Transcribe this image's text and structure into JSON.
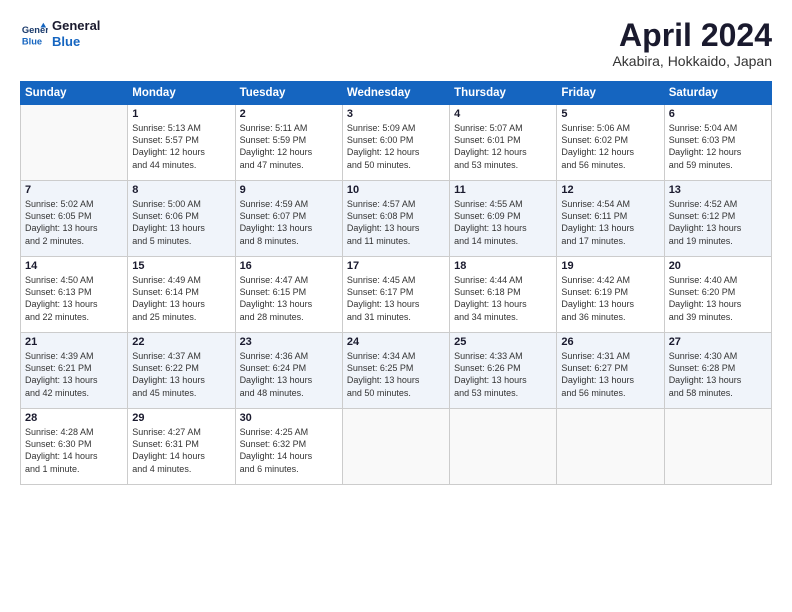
{
  "logo": {
    "line1": "General",
    "line2": "Blue"
  },
  "title": "April 2024",
  "location": "Akabira, Hokkaido, Japan",
  "days_of_week": [
    "Sunday",
    "Monday",
    "Tuesday",
    "Wednesday",
    "Thursday",
    "Friday",
    "Saturday"
  ],
  "weeks": [
    [
      {
        "num": "",
        "info": ""
      },
      {
        "num": "1",
        "info": "Sunrise: 5:13 AM\nSunset: 5:57 PM\nDaylight: 12 hours\nand 44 minutes."
      },
      {
        "num": "2",
        "info": "Sunrise: 5:11 AM\nSunset: 5:59 PM\nDaylight: 12 hours\nand 47 minutes."
      },
      {
        "num": "3",
        "info": "Sunrise: 5:09 AM\nSunset: 6:00 PM\nDaylight: 12 hours\nand 50 minutes."
      },
      {
        "num": "4",
        "info": "Sunrise: 5:07 AM\nSunset: 6:01 PM\nDaylight: 12 hours\nand 53 minutes."
      },
      {
        "num": "5",
        "info": "Sunrise: 5:06 AM\nSunset: 6:02 PM\nDaylight: 12 hours\nand 56 minutes."
      },
      {
        "num": "6",
        "info": "Sunrise: 5:04 AM\nSunset: 6:03 PM\nDaylight: 12 hours\nand 59 minutes."
      }
    ],
    [
      {
        "num": "7",
        "info": "Sunrise: 5:02 AM\nSunset: 6:05 PM\nDaylight: 13 hours\nand 2 minutes."
      },
      {
        "num": "8",
        "info": "Sunrise: 5:00 AM\nSunset: 6:06 PM\nDaylight: 13 hours\nand 5 minutes."
      },
      {
        "num": "9",
        "info": "Sunrise: 4:59 AM\nSunset: 6:07 PM\nDaylight: 13 hours\nand 8 minutes."
      },
      {
        "num": "10",
        "info": "Sunrise: 4:57 AM\nSunset: 6:08 PM\nDaylight: 13 hours\nand 11 minutes."
      },
      {
        "num": "11",
        "info": "Sunrise: 4:55 AM\nSunset: 6:09 PM\nDaylight: 13 hours\nand 14 minutes."
      },
      {
        "num": "12",
        "info": "Sunrise: 4:54 AM\nSunset: 6:11 PM\nDaylight: 13 hours\nand 17 minutes."
      },
      {
        "num": "13",
        "info": "Sunrise: 4:52 AM\nSunset: 6:12 PM\nDaylight: 13 hours\nand 19 minutes."
      }
    ],
    [
      {
        "num": "14",
        "info": "Sunrise: 4:50 AM\nSunset: 6:13 PM\nDaylight: 13 hours\nand 22 minutes."
      },
      {
        "num": "15",
        "info": "Sunrise: 4:49 AM\nSunset: 6:14 PM\nDaylight: 13 hours\nand 25 minutes."
      },
      {
        "num": "16",
        "info": "Sunrise: 4:47 AM\nSunset: 6:15 PM\nDaylight: 13 hours\nand 28 minutes."
      },
      {
        "num": "17",
        "info": "Sunrise: 4:45 AM\nSunset: 6:17 PM\nDaylight: 13 hours\nand 31 minutes."
      },
      {
        "num": "18",
        "info": "Sunrise: 4:44 AM\nSunset: 6:18 PM\nDaylight: 13 hours\nand 34 minutes."
      },
      {
        "num": "19",
        "info": "Sunrise: 4:42 AM\nSunset: 6:19 PM\nDaylight: 13 hours\nand 36 minutes."
      },
      {
        "num": "20",
        "info": "Sunrise: 4:40 AM\nSunset: 6:20 PM\nDaylight: 13 hours\nand 39 minutes."
      }
    ],
    [
      {
        "num": "21",
        "info": "Sunrise: 4:39 AM\nSunset: 6:21 PM\nDaylight: 13 hours\nand 42 minutes."
      },
      {
        "num": "22",
        "info": "Sunrise: 4:37 AM\nSunset: 6:22 PM\nDaylight: 13 hours\nand 45 minutes."
      },
      {
        "num": "23",
        "info": "Sunrise: 4:36 AM\nSunset: 6:24 PM\nDaylight: 13 hours\nand 48 minutes."
      },
      {
        "num": "24",
        "info": "Sunrise: 4:34 AM\nSunset: 6:25 PM\nDaylight: 13 hours\nand 50 minutes."
      },
      {
        "num": "25",
        "info": "Sunrise: 4:33 AM\nSunset: 6:26 PM\nDaylight: 13 hours\nand 53 minutes."
      },
      {
        "num": "26",
        "info": "Sunrise: 4:31 AM\nSunset: 6:27 PM\nDaylight: 13 hours\nand 56 minutes."
      },
      {
        "num": "27",
        "info": "Sunrise: 4:30 AM\nSunset: 6:28 PM\nDaylight: 13 hours\nand 58 minutes."
      }
    ],
    [
      {
        "num": "28",
        "info": "Sunrise: 4:28 AM\nSunset: 6:30 PM\nDaylight: 14 hours\nand 1 minute."
      },
      {
        "num": "29",
        "info": "Sunrise: 4:27 AM\nSunset: 6:31 PM\nDaylight: 14 hours\nand 4 minutes."
      },
      {
        "num": "30",
        "info": "Sunrise: 4:25 AM\nSunset: 6:32 PM\nDaylight: 14 hours\nand 6 minutes."
      },
      {
        "num": "",
        "info": ""
      },
      {
        "num": "",
        "info": ""
      },
      {
        "num": "",
        "info": ""
      },
      {
        "num": "",
        "info": ""
      }
    ]
  ]
}
